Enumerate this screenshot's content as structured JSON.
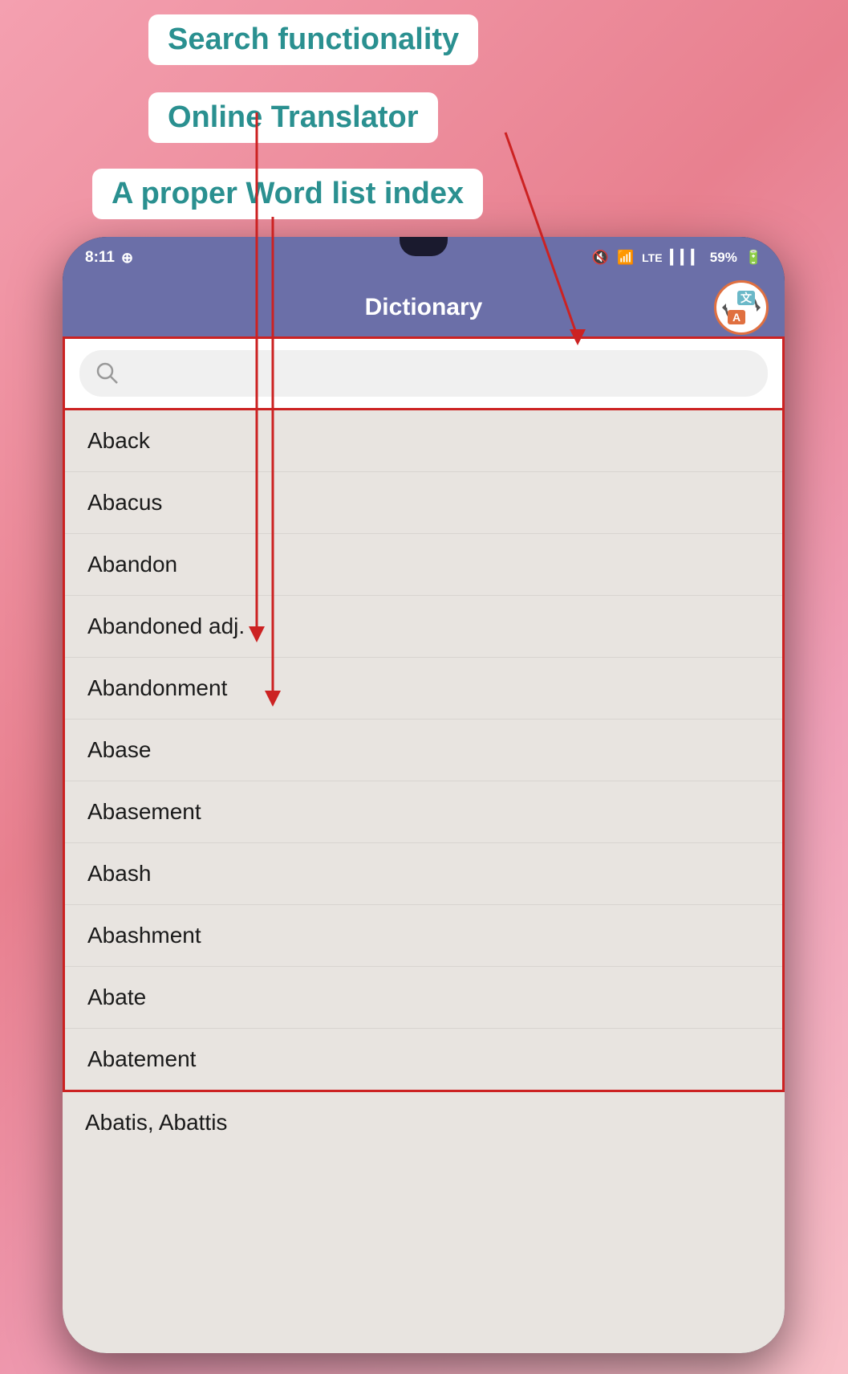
{
  "annotations": {
    "search_label": "Search functionality",
    "translator_label": "Online Translator",
    "wordlist_label": "A proper Word list index"
  },
  "status_bar": {
    "time": "8:11",
    "whatsapp_icon": "whatsapp",
    "mute_icon": "mute",
    "wifi_icon": "wifi",
    "lte_icon": "LTE",
    "signal_icon": "signal",
    "battery": "59%"
  },
  "header": {
    "title": "Dictionary",
    "translate_top": "文",
    "translate_bottom": "A"
  },
  "search": {
    "placeholder": ""
  },
  "word_list": [
    "Aback",
    "Abacus",
    "Abandon",
    "Abandoned adj.",
    "Abandonment",
    "Abase",
    "Abasement",
    "Abash",
    "Abashment",
    "Abate",
    "Abatement"
  ],
  "word_list_outside": "Abatis, Abattis",
  "colors": {
    "header_bg": "#6b6fa8",
    "header_text": "#ffffff",
    "list_bg": "#e8e4e0",
    "border_red": "#cc2222",
    "annotation_text": "#2a9090",
    "annotation_bg": "#ffffff",
    "translate_top_bg": "#6ab8c8",
    "translate_bottom_bg": "#e07040"
  }
}
